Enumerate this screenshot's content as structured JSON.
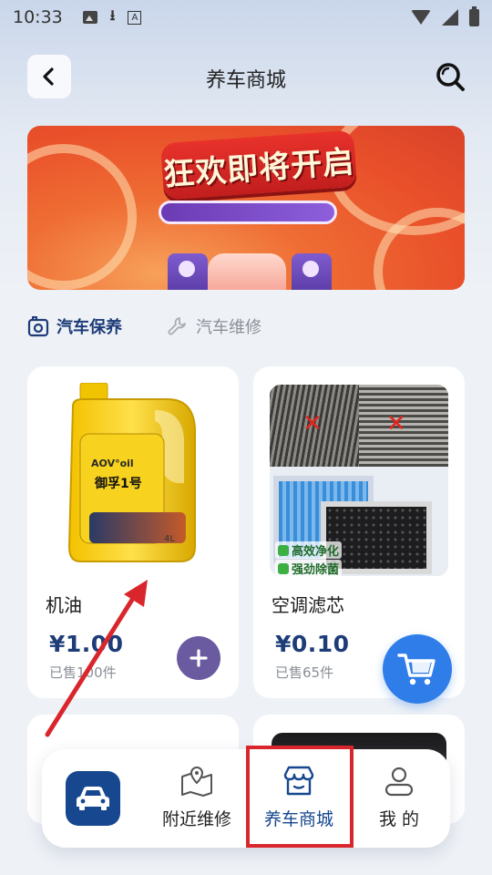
{
  "status_bar": {
    "time": "10:33",
    "a_badge": "A"
  },
  "header": {
    "title": "养车商城",
    "back_icon": "chevron-left-icon",
    "search_icon": "search-icon"
  },
  "banner": {
    "headline": "狂欢即将开启"
  },
  "categories": [
    {
      "label": "汽车保养",
      "icon": "car-maintenance-icon",
      "active": true
    },
    {
      "label": "汽车维修",
      "icon": "wrench-icon",
      "active": false
    }
  ],
  "products": [
    {
      "name": "机油",
      "price": "¥1.00",
      "sold": "已售100件",
      "image_brand": "AOV°oil",
      "image_subtitle": "御孚1号",
      "image_volume": "4L",
      "action_icon": "plus-icon"
    },
    {
      "name": "空调滤芯",
      "price": "¥0.10",
      "sold": "已售65件",
      "image_tags": [
        "高效净化",
        "强劲除菌"
      ],
      "action_icon": "cart-icon"
    }
  ],
  "bottom_nav": {
    "items": [
      {
        "label": "附近维修",
        "icon": "map-pin-icon",
        "active": false
      },
      {
        "label": "养车商城",
        "icon": "store-icon",
        "active": true
      },
      {
        "label": "我 的",
        "icon": "user-icon",
        "active": false
      }
    ],
    "home_icon": "car-icon"
  },
  "colors": {
    "accent_navy": "#16478f",
    "price_blue": "#1d3c78",
    "add_button_purple": "#6a5aa0",
    "cart_button_blue": "#2f7de8",
    "annotation_red": "#d9262c"
  }
}
